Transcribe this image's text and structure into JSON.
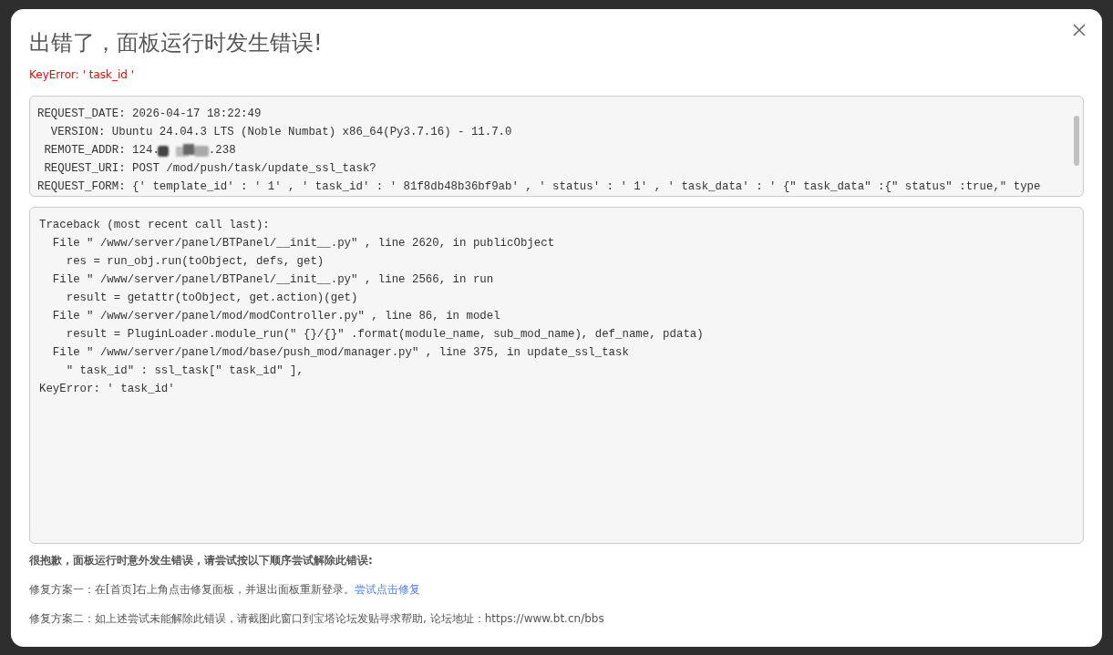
{
  "dialog": {
    "title": "出错了，面板运行时发生错误!",
    "error_summary": "KeyError: ' task_id '"
  },
  "request_info": [
    {
      "kind": "text",
      "text": "REQUEST_DATE: 2026-04-17 18:22:49"
    },
    {
      "kind": "text",
      "text": "  VERSION: Ubuntu 24.04.3 LTS (Noble Numbat) x86_64(Py3.7.16) - 11.7.0"
    },
    {
      "kind": "redacted",
      "before": " REMOTE_ADDR: 124.",
      "after": ".238"
    },
    {
      "kind": "text",
      "text": " REQUEST_URI: POST /mod/push/task/update_ssl_task?"
    },
    {
      "kind": "text",
      "text": "REQUEST_FORM: {' template_id' : ' 1' , ' task_id' : ' 81f8db48b36bf9ab' , ' status' : ' 1' , ' task_data' : ' {\" task_data\" :{\" status\" :true,\" type"
    }
  ],
  "traceback": [
    "Traceback (most recent call last):",
    "  File \" /www/server/panel/BTPanel/__init__.py\" , line 2620, in publicObject",
    "    res = run_obj.run(toObject, defs, get)",
    "  File \" /www/server/panel/BTPanel/__init__.py\" , line 2566, in run",
    "    result = getattr(toObject, get.action)(get)",
    "  File \" /www/server/panel/mod/modController.py\" , line 86, in model",
    "    result = PluginLoader.module_run(\" {}/{}\" .format(module_name, sub_mod_name), def_name, pdata)",
    "  File \" /www/server/panel/mod/base/push_mod/manager.py\" , line 375, in update_ssl_task",
    "    \" task_id\" : ssl_task[\" task_id\" ],",
    "KeyError: ' task_id'"
  ],
  "help": {
    "heading": "很抱歉，面板运行时意外发生错误，请尝试按以下顺序尝试解除此错误:",
    "fix_1": {
      "text": "修复方案一：在[首页]右上角点击修复面板，并退出面板重新登录。",
      "link": "尝试点击修复"
    },
    "fix_2": {
      "text": "修复方案二：如上述尝试未能解除此错误，请截图此窗口到宝塔论坛发贴寻求帮助, 论坛地址：https://www.bt.cn/bbs"
    }
  }
}
